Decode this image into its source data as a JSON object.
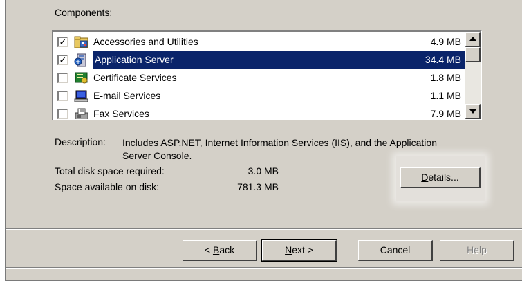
{
  "components_label_prefix": "C",
  "components_label_rest": "omponents:",
  "components": [
    {
      "name": "Accessories and Utilities",
      "size": "4.9 MB",
      "checked": true,
      "selected": false,
      "icon": "accessories-icon"
    },
    {
      "name": "Application Server",
      "size": "34.4 MB",
      "checked": true,
      "selected": true,
      "icon": "application-server-icon"
    },
    {
      "name": "Certificate Services",
      "size": "1.8 MB",
      "checked": false,
      "selected": false,
      "icon": "certificate-icon"
    },
    {
      "name": "E-mail Services",
      "size": "1.1 MB",
      "checked": false,
      "selected": false,
      "icon": "email-icon"
    },
    {
      "name": "Fax Services",
      "size": "7.9 MB",
      "checked": false,
      "selected": false,
      "icon": "fax-icon"
    }
  ],
  "description": {
    "label": "Description:",
    "text": "Includes ASP.NET, Internet Information Services (IIS), and the Application Server Console."
  },
  "disk": {
    "required_label": "Total disk space required:",
    "required_value": "3.0 MB",
    "available_label": "Space available on disk:",
    "available_value": "781.3 MB"
  },
  "buttons": {
    "details": {
      "prefix": "D",
      "rest": "etails..."
    },
    "back": {
      "pre": "< ",
      "ul": "B",
      "rest": "ack"
    },
    "next": {
      "ul": "N",
      "rest": "ext >"
    },
    "cancel": "Cancel",
    "help": "Help"
  },
  "colors": {
    "face": "#d4d0c8",
    "selection": "#0a246a"
  }
}
